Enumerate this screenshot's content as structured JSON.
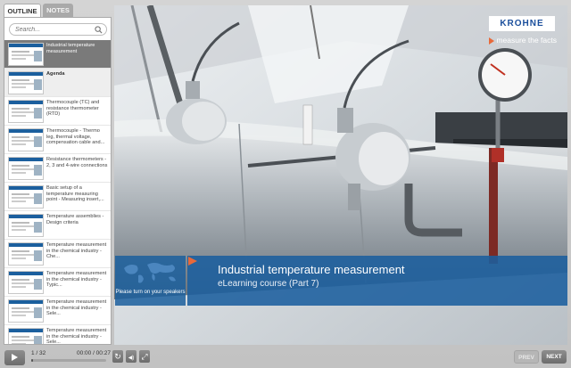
{
  "sidebar": {
    "tabs": [
      {
        "label": "OUTLINE",
        "active": true
      },
      {
        "label": "NOTES",
        "active": false
      }
    ],
    "search": {
      "placeholder": "Search...",
      "icon": "search-icon"
    },
    "items": [
      {
        "label": "Industrial temperature measurement",
        "state": "selected"
      },
      {
        "label": "Agenda",
        "state": "hovered"
      },
      {
        "label": "Thermocouple (TC) and resistance thermometer (RTD)",
        "state": "normal"
      },
      {
        "label": "Thermocouple - Thermo leg, thermal voltage, compensation cable and...",
        "state": "normal"
      },
      {
        "label": "Resistance thermometers - 2, 3 and 4-wire connections",
        "state": "normal"
      },
      {
        "label": "Basic setup of a temperature measuring point - Measuring insert,...",
        "state": "normal"
      },
      {
        "label": "Temperature assemblies - Design criteria",
        "state": "normal"
      },
      {
        "label": "Temperature measurement in the chemical industry - Che...",
        "state": "normal"
      },
      {
        "label": "Temperature measurement in the chemical industry - Typic...",
        "state": "normal"
      },
      {
        "label": "Temperature measurement in the chemical industry - Sele...",
        "state": "normal"
      },
      {
        "label": "Temperature measurement in the chemical industry - Sele...",
        "state": "normal"
      }
    ]
  },
  "stage": {
    "brand": "KROHNE",
    "tagline": "measure the facts",
    "speaker_notice": "Please turn on your speakers",
    "title": "Industrial temperature measurement",
    "subtitle": "eLearning course (Part 7)",
    "colors": {
      "title_box": "#1b5f9e",
      "accent_arrow": "#e8693a",
      "brand": "#1b4f9c"
    }
  },
  "player": {
    "slide_counter": "1 / 32",
    "time": "00:00 / 00:27",
    "progress_fraction": 0.02,
    "controls": [
      {
        "name": "replay-icon",
        "glyph": "↻"
      },
      {
        "name": "volume-icon",
        "glyph": "◀)"
      },
      {
        "name": "fullscreen-icon",
        "glyph": "⤢"
      }
    ],
    "prev_label": "PREV",
    "next_label": "NEXT"
  }
}
